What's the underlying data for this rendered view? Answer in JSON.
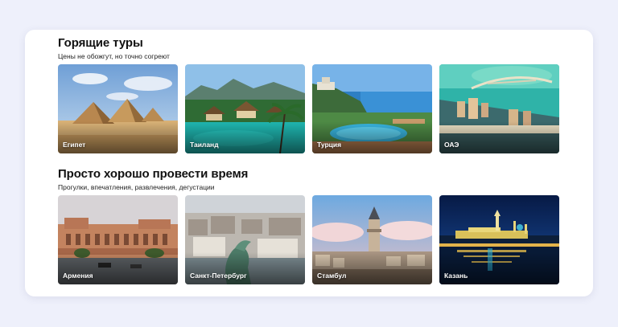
{
  "sections": [
    {
      "title": "Горящие туры",
      "subtitle": "Цены не обожгут, но точно согреют",
      "cards": [
        {
          "label": "Египет"
        },
        {
          "label": "Таиланд"
        },
        {
          "label": "Турция"
        },
        {
          "label": "ОАЭ"
        }
      ]
    },
    {
      "title": "Просто хорошо провести время",
      "subtitle": "Прогулки, впечатления, развлечения, дегустации",
      "cards": [
        {
          "label": "Армения"
        },
        {
          "label": "Санкт-Петербург"
        },
        {
          "label": "Стамбул"
        },
        {
          "label": "Казань"
        }
      ]
    }
  ]
}
